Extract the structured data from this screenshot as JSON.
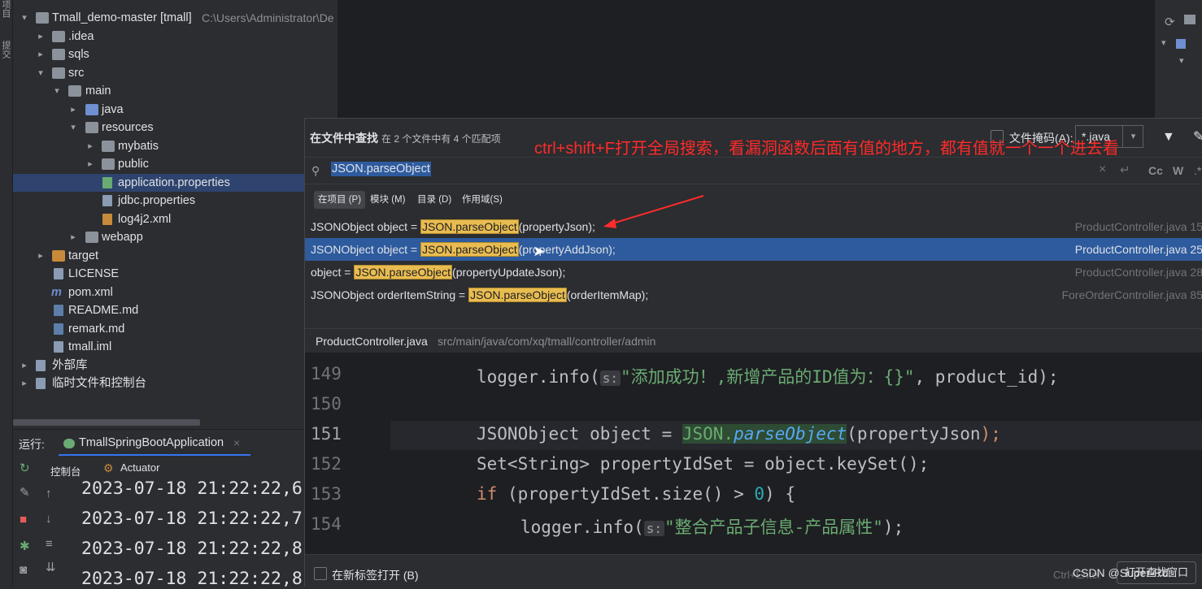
{
  "left_strip": {
    "label_top": "项目",
    "label_mid": "提交"
  },
  "project": {
    "root": {
      "name": "Tmall_demo-master [tmall]",
      "path": "C:\\Users\\Administrator\\De"
    },
    "items": [
      {
        "label": ".idea"
      },
      {
        "label": "sqls"
      },
      {
        "label": "src"
      },
      {
        "label": "main"
      },
      {
        "label": "java"
      },
      {
        "label": "resources"
      },
      {
        "label": "mybatis"
      },
      {
        "label": "public"
      },
      {
        "label": "application.properties"
      },
      {
        "label": "jdbc.properties"
      },
      {
        "label": "log4j2.xml"
      },
      {
        "label": "webapp"
      },
      {
        "label": "target"
      },
      {
        "label": "LICENSE"
      },
      {
        "label": "pom.xml"
      },
      {
        "label": "README.md"
      },
      {
        "label": "remark.md"
      },
      {
        "label": "tmall.iml"
      },
      {
        "label": "外部库"
      },
      {
        "label": "临时文件和控制台"
      }
    ]
  },
  "run": {
    "label": "运行:",
    "tab": "TmallSpringBootApplication",
    "console_tab": "控制台",
    "actuator_tab": "Actuator",
    "logs": [
      "2023-07-18 21:22:22,6",
      "2023-07-18 21:22:22,7",
      "2023-07-18 21:22:22,8",
      "2023-07-18 21:22:22,8"
    ]
  },
  "find": {
    "title": "在文件中查找",
    "count": "在 2 个文件中有 4 个匹配项",
    "annotation": "ctrl+shift+F打开全局搜索，看漏洞函数后面有值的地方，都有值就一个一个进去看",
    "file_mask_label": "文件掩码(A):",
    "file_mask_value": "*.java",
    "query": "JSON.parseObject",
    "match_case": "Cc",
    "whole_word": "W",
    "regex": ".*",
    "scopes": [
      "在项目 (P)",
      "模块 (M)",
      "目录 (D)",
      "作用域(S)"
    ],
    "results": [
      {
        "before": "JSONObject object = ",
        "match": "JSON.parseObject",
        "after": "(propertyJson);",
        "location": "ProductController.java 15"
      },
      {
        "before": "JSONObject object = ",
        "match": "JSON.parseObject",
        "after": "(propertyAddJson);",
        "location": "ProductController.java 25"
      },
      {
        "before": "object = ",
        "match": "JSON.parseObject",
        "after": "(propertyUpdateJson);",
        "location": "ProductController.java 28"
      },
      {
        "before": "JSONObject orderItemString = ",
        "match": "JSON.parseObject",
        "after": "(orderItemMap);",
        "location": "ForeOrderController.java 85"
      }
    ],
    "preview_file": "ProductController.java",
    "preview_path": "src/main/java/com/xq/tmall/controller/admin",
    "code": {
      "lines": [
        "149",
        "150",
        "151",
        "152",
        "153",
        "154"
      ],
      "l149_a": "logger.info(",
      "l149_hint": "s:",
      "l149_str": "\"添加成功！,新增产品的ID值为：{}\"",
      "l149_b": ", product_id);",
      "l151_a": "JSONObject object = ",
      "l151_json": "JSON.",
      "l151_parse": "parseObject",
      "l151_b": "(propertyJson",
      "l151_c": ");",
      "l152": "Set<String> propertyIdSet = object.keySet();",
      "l153_if": "if",
      "l153_a": " (propertyIdSet.size() > ",
      "l153_num": "0",
      "l153_b": ") {",
      "l154_a": "logger.info(",
      "l154_hint": "s:",
      "l154_str": "\"整合产品子信息-产品属性\"",
      "l154_b": ");"
    },
    "new_tab_label": "在新标签打开 (B)",
    "shortcut": "Ctrl+Enter",
    "open_button": "打开查找窗口",
    "watermark": "CSDN @Super-Rd"
  }
}
